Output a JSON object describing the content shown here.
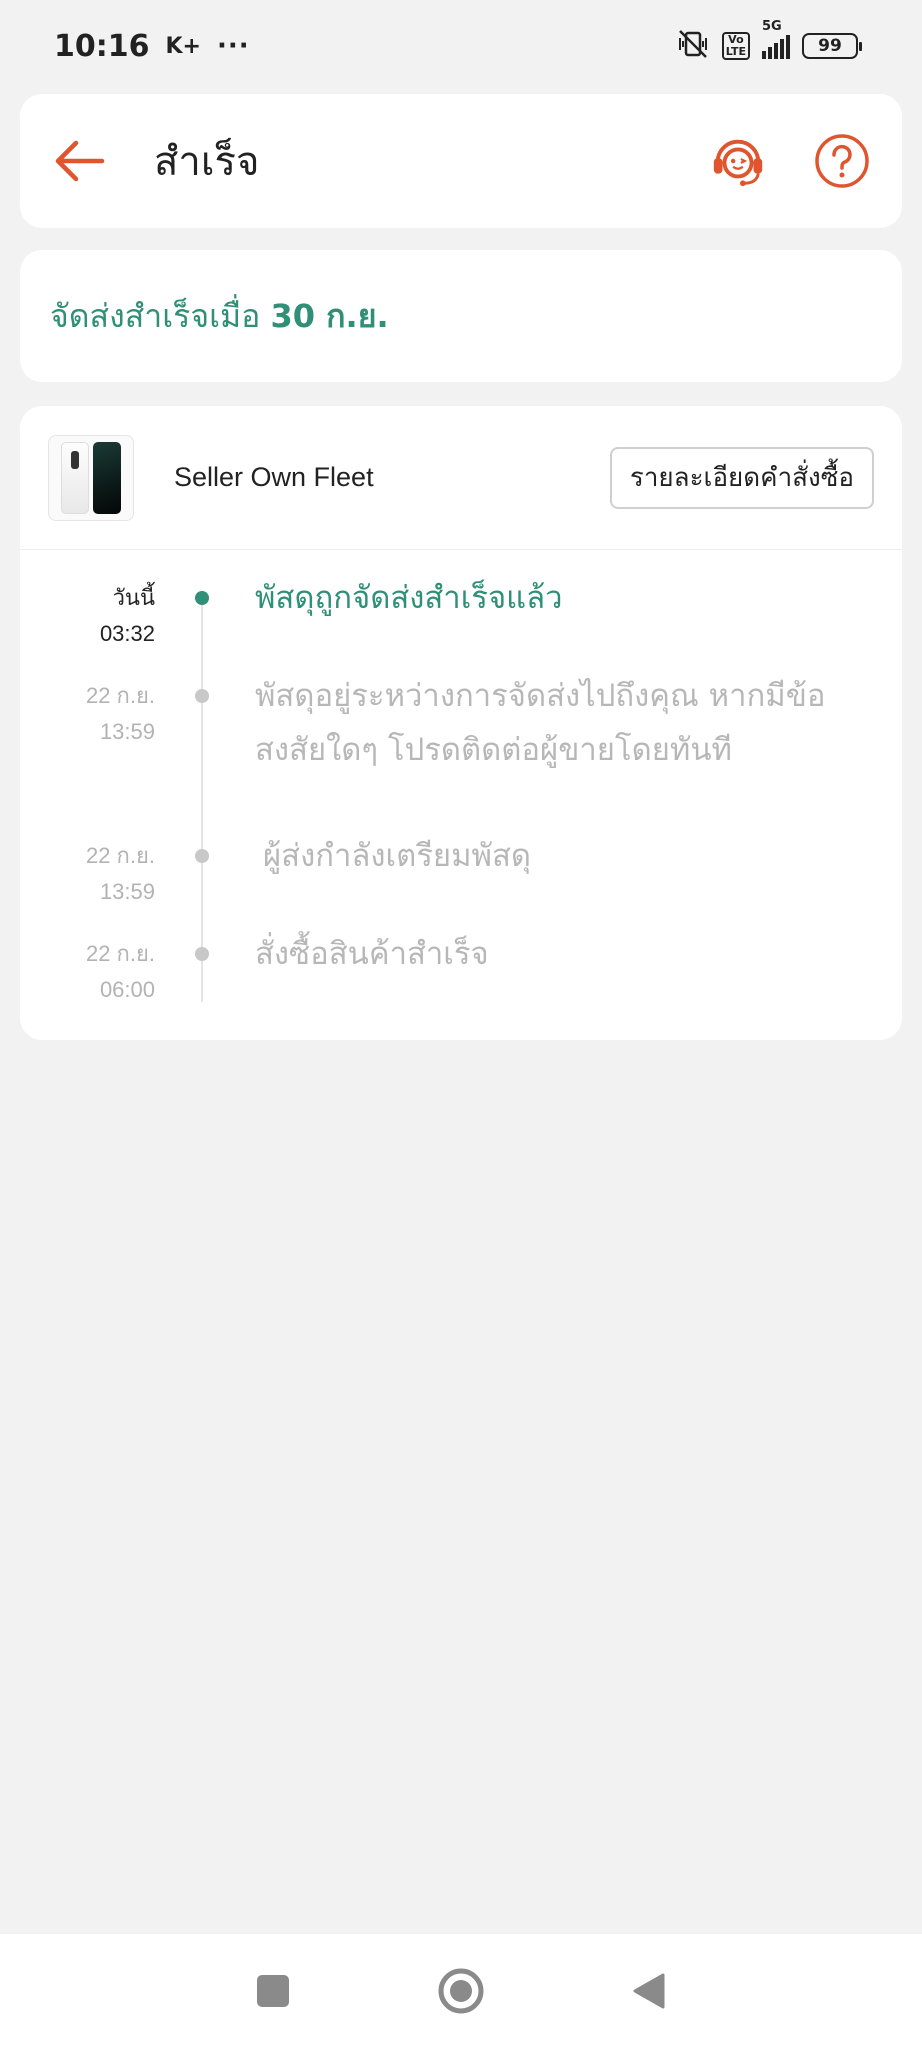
{
  "status_bar": {
    "time": "10:16",
    "carrier_badge": "K+",
    "more": "···",
    "battery": "99",
    "network": "5G",
    "volte": "Vo LTE"
  },
  "header": {
    "title": "สำเร็จ",
    "back_icon": "back-arrow-icon",
    "support_icon": "customer-support-icon",
    "help_icon": "help-icon"
  },
  "delivery_status": {
    "prefix": "จัดส่งสำเร็จเมื่อ ",
    "date": "30 ก.ย."
  },
  "shipment": {
    "carrier": "Seller Own Fleet",
    "order_details_label": "รายละเอียดคำสั่งซื้อ"
  },
  "timeline": [
    {
      "date": "วันนี้",
      "time": "03:32",
      "message": "พัสดุถูกจัดส่งสำเร็จแล้ว",
      "active": true
    },
    {
      "date": "22 ก.ย.",
      "time": "13:59",
      "message": "พัสดุอยู่ระหว่างการจัดส่งไปถึงคุณ หากมีข้อสงสัยใดๆ โปรดติดต่อผู้ขายโดยทันที",
      "active": false
    },
    {
      "date": "22 ก.ย.",
      "time": "13:59",
      "message": "ผู้ส่งกำลังเตรียมพัสดุ",
      "active": false
    },
    {
      "date": "22 ก.ย.",
      "time": "06:00",
      "message": "สั่งซื้อสินค้าสำเร็จ",
      "active": false
    }
  ],
  "colors": {
    "accent_orange": "#e0542e",
    "success_green": "#2f8f77",
    "muted_gray": "#b7b7b7"
  },
  "nav_bar": {
    "recents_icon": "square-icon",
    "home_icon": "circle-home-icon",
    "back_icon": "triangle-back-icon"
  }
}
